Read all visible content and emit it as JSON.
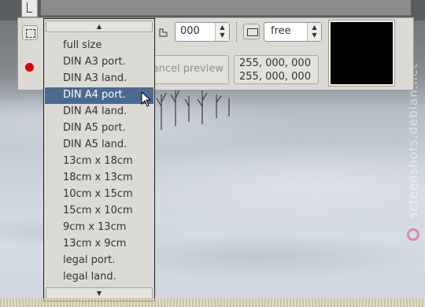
{
  "toolbar": {
    "number_value": "000",
    "ratio_mode": "free",
    "cancel_preview_label": "ancel preview",
    "color_readout": [
      "255, 000, 000",
      "255, 000, 000"
    ],
    "preview_color": "#000000",
    "record_color": "#e10000"
  },
  "dropdown": {
    "scroll_up_icon": "▲",
    "scroll_down_icon": "▼",
    "selected_index": 3,
    "items": [
      "full size",
      "DIN A3 port.",
      "DIN A3 land.",
      "DIN A4 port.",
      "DIN A4 land.",
      "DIN A5 port.",
      "DIN A5 land.",
      "13cm x 18cm",
      "18cm x 13cm",
      "10cm x 15cm",
      "15cm x 10cm",
      "9cm x 13cm",
      "13cm x 9cm",
      "legal port.",
      "legal land."
    ]
  },
  "watermark": {
    "text": "screenshots.debian.net"
  }
}
